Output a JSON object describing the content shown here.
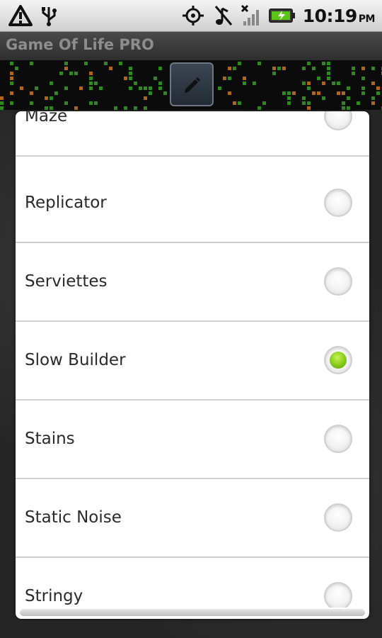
{
  "status_bar": {
    "time": "10:19",
    "ampm": "PM",
    "icons": [
      "alert-icon",
      "usb-icon",
      "gps-icon",
      "silent-icon",
      "no-signal-icon",
      "battery-charging-icon"
    ]
  },
  "app": {
    "title": "Game Of Life PRO"
  },
  "dialog": {
    "items": [
      {
        "label": "Maze",
        "checked": false
      },
      {
        "label": "Replicator",
        "checked": false
      },
      {
        "label": "Serviettes",
        "checked": false
      },
      {
        "label": "Slow Builder",
        "checked": true
      },
      {
        "label": "Stains",
        "checked": false
      },
      {
        "label": "Static Noise",
        "checked": false
      },
      {
        "label": "Stringy",
        "checked": false
      }
    ]
  },
  "colors": {
    "checked_radio": "#8fd21e",
    "live_cell": "#2e8a1e",
    "highlight_cell": "#b0641c"
  }
}
